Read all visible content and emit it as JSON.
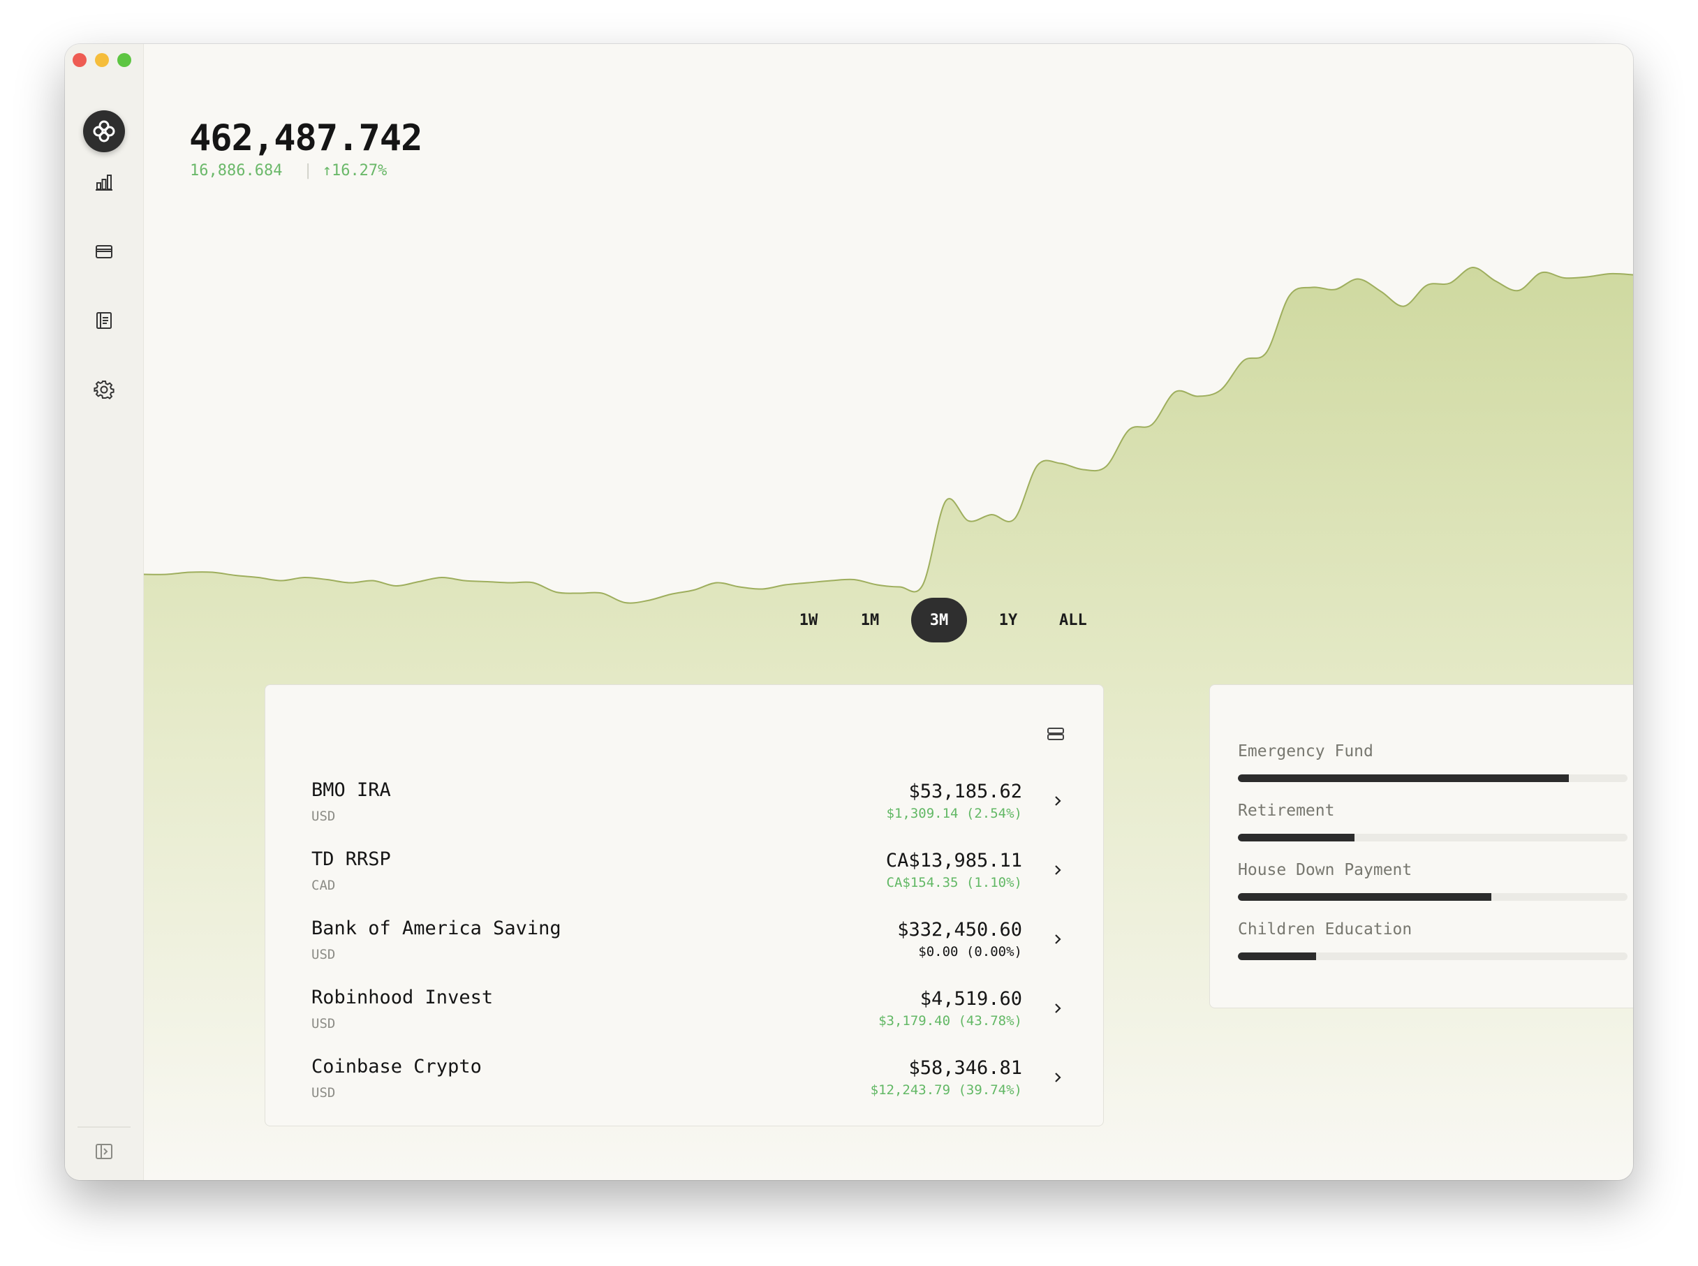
{
  "summary": {
    "total": "462,487.742",
    "change": "16,886.684",
    "separator": "|",
    "change_pct": "↑16.27%"
  },
  "colors": {
    "accent_green": "#6ab869",
    "chart_fill": "#cfd9a0",
    "chart_line": "#9eae5d",
    "dark": "#2f2f2f"
  },
  "sidebar": {
    "items": [
      {
        "icon": "bar-chart-icon"
      },
      {
        "icon": "wallet-icon"
      },
      {
        "icon": "ledger-icon"
      },
      {
        "icon": "gear-icon"
      }
    ],
    "footer_icon": "sidebar-toggle-icon"
  },
  "chart_data": {
    "type": "area",
    "series": [
      {
        "values": [
          3.0,
          3.0,
          3.2,
          3.2,
          2.9,
          2.7,
          2.4,
          2.7,
          2.5,
          2.2,
          2.4,
          1.9,
          2.3,
          2.7,
          2.4,
          2.3,
          2.2,
          2.2,
          1.3,
          1.2,
          1.2,
          0.3,
          0.5,
          1.1,
          1.5,
          2.2,
          1.8,
          1.6,
          2.0,
          2.2,
          2.4,
          2.5,
          2.0,
          1.8,
          2.0,
          10.0,
          8.1,
          8.7,
          8.3,
          13.4,
          13.6,
          13.0,
          13.3,
          16.8,
          17.3,
          20.4,
          20.0,
          20.6,
          23.4,
          24.2,
          29.6,
          30.4,
          30.2,
          31.2,
          30.0,
          28.6,
          30.6,
          30.8,
          32.3,
          31.0,
          30.1,
          31.8,
          31.3,
          31.4,
          31.7,
          31.6
        ]
      }
    ],
    "grid": false,
    "legend": "none"
  },
  "ranges": [
    {
      "label": "1W",
      "active": false
    },
    {
      "label": "1M",
      "active": false
    },
    {
      "label": "3M",
      "active": true
    },
    {
      "label": "1Y",
      "active": false
    },
    {
      "label": "ALL",
      "active": false
    }
  ],
  "accounts": [
    {
      "name": "BMO IRA",
      "currency": "USD",
      "value": "$53,185.62",
      "change": "$1,309.14 (2.54%)",
      "trend": "pos"
    },
    {
      "name": "TD RRSP",
      "currency": "CAD",
      "value": "CA$13,985.11",
      "change": "CA$154.35 (1.10%)",
      "trend": "pos"
    },
    {
      "name": "Bank of America Saving",
      "currency": "USD",
      "value": "$332,450.60",
      "change": "$0.00 (0.00%)",
      "trend": "flat"
    },
    {
      "name": "Robinhood Invest",
      "currency": "USD",
      "value": "$4,519.60",
      "change": "$3,179.40 (43.78%)",
      "trend": "pos"
    },
    {
      "name": "Coinbase Crypto",
      "currency": "USD",
      "value": "$58,346.81",
      "change": "$12,243.79 (39.74%)",
      "trend": "pos"
    }
  ],
  "goals": [
    {
      "label": "Emergency Fund",
      "progress": 0.85
    },
    {
      "label": "Retirement",
      "progress": 0.3
    },
    {
      "label": "House Down Payment",
      "progress": 0.65
    },
    {
      "label": "Children Education",
      "progress": 0.2
    }
  ]
}
